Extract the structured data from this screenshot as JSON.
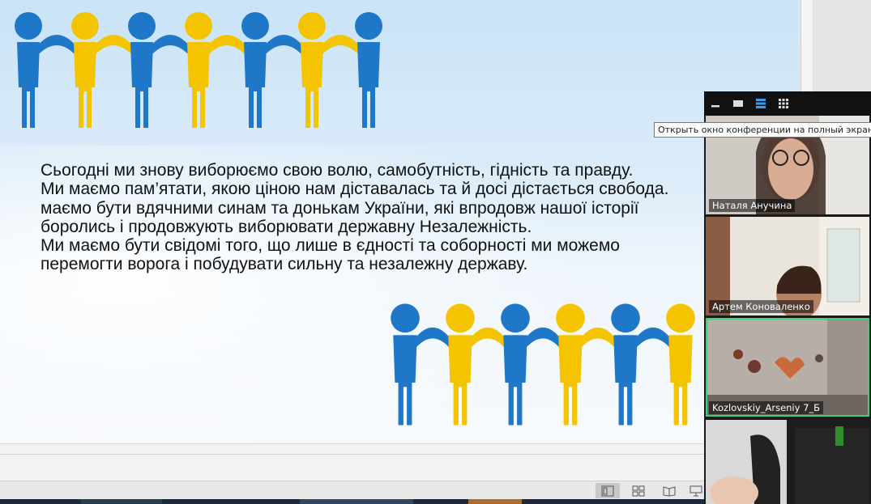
{
  "slide": {
    "lines": [
      "Сьогодні ми знову виборюємо свою волю, самобутність, гідність та правду.",
      "Ми маємо пам’ятати, якою ціною нам діставалась та й досі дістається свобода.",
      "маємо бути вдячними синам та донькам України, які впродовж нашої історії",
      "боролись і продовжують виборювати державну Незалежність.",
      "Ми маємо бути свідомі того, що лише в єдності та соборності ми можемо",
      "перемогти ворога і побудувати сильну та незалежну державу."
    ],
    "colors": {
      "blue": "#1f77c8",
      "yellow": "#f5c400"
    }
  },
  "zoom": {
    "tooltip": "Открыть окно конференции на полный экран",
    "toolbar_icons": [
      "minimize-icon",
      "speaker-view-icon",
      "strip-view-icon",
      "gallery-view-icon"
    ],
    "participants": [
      {
        "name": "Наталя Анучина"
      },
      {
        "name": "Артем Коноваленко"
      },
      {
        "name": "Kozlovskiy_Arseniy 7_Б"
      },
      {
        "name": ""
      }
    ]
  },
  "statusbar": {
    "icons": [
      "normal-view-icon",
      "slide-sorter-icon",
      "reading-view-icon",
      "slideshow-icon"
    ]
  }
}
